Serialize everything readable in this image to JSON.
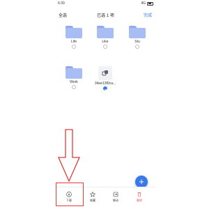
{
  "status": {
    "time": "6:39",
    "signal": "4G"
  },
  "header": {
    "select_all": "全选",
    "title": "已选 1 项",
    "done": "完成"
  },
  "items": [
    {
      "name": "Life",
      "meta": "",
      "type": "folder",
      "checked": false
    },
    {
      "name": "Like",
      "meta": "",
      "type": "folder",
      "checked": false
    },
    {
      "name": "Stu",
      "meta": "",
      "type": "folder",
      "checked": false
    },
    {
      "name": "Work",
      "meta": "",
      "type": "folder",
      "checked": false
    },
    {
      "name": "34ee13f9ca...",
      "meta": "",
      "type": "file",
      "checked": true
    }
  ],
  "fab": {
    "label": "+"
  },
  "bottom_tabs": [
    {
      "label": "下载",
      "icon": "download-icon"
    },
    {
      "label": "收藏",
      "icon": "star-icon"
    },
    {
      "label": "移动",
      "icon": "move-icon"
    },
    {
      "label": "删除",
      "icon": "trash-icon"
    }
  ],
  "colors": {
    "accent": "#3a78e6",
    "folder": "#a9bdf5",
    "annotation": "#e03a3a",
    "delete": "#e0584f"
  }
}
